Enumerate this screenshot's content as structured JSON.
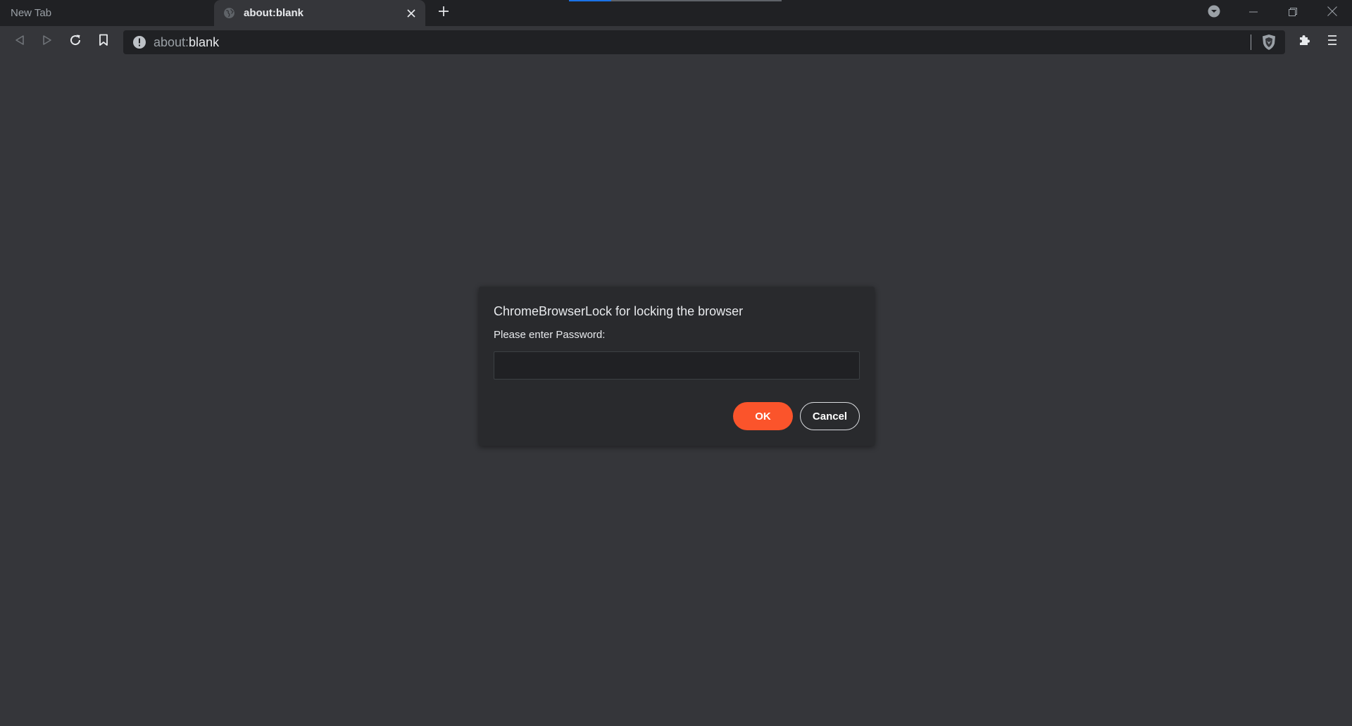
{
  "tabs": [
    {
      "title": "New Tab",
      "active": false
    },
    {
      "title": "about:blank",
      "active": true
    }
  ],
  "load_progress": 0.2,
  "toolbar": {
    "url_scheme": "about:",
    "url_rest": "blank"
  },
  "icons": {
    "favicon": "globe-icon",
    "tab_close": "close-icon",
    "new_tab": "plus-icon",
    "tab_search": "chevron-down-icon",
    "minimize": "minimize-icon",
    "restore": "restore-icon",
    "close": "close-icon",
    "back": "back-icon",
    "forward": "forward-icon",
    "reload": "reload-icon",
    "bookmark": "bookmark-icon",
    "site_info": "info-icon",
    "shields": "brave-shields-icon",
    "extensions": "puzzle-icon",
    "menu": "hamburger-menu-icon"
  },
  "dialog": {
    "title": "ChromeBrowserLock for locking the browser",
    "label": "Please enter Password:",
    "input_value": "",
    "ok_label": "OK",
    "cancel_label": "Cancel"
  },
  "colors": {
    "accent": "#fb542b",
    "background": "#35363a",
    "tabstrip": "#202124",
    "progress": "#1a73e8"
  }
}
